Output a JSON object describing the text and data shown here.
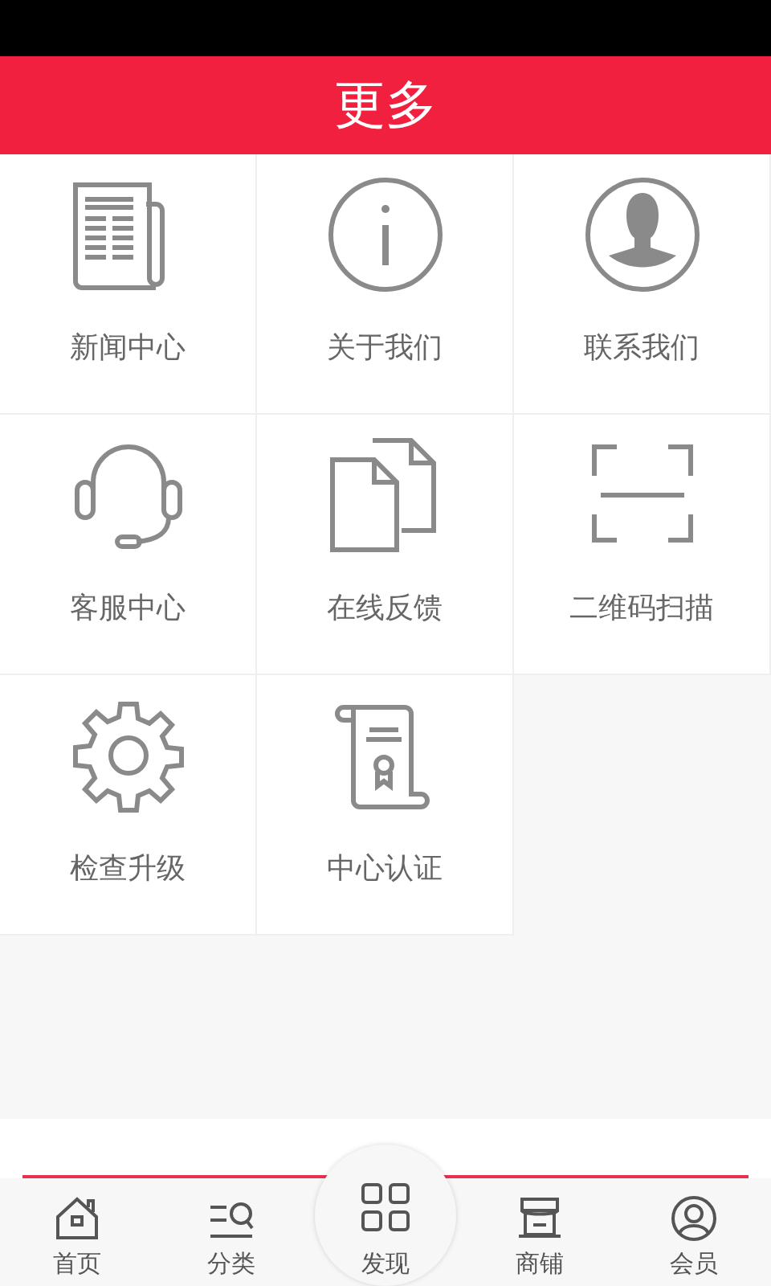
{
  "header": {
    "title": "更多"
  },
  "grid": [
    {
      "label": "新闻中心"
    },
    {
      "label": "关于我们"
    },
    {
      "label": "联系我们"
    },
    {
      "label": "客服中心"
    },
    {
      "label": "在线反馈"
    },
    {
      "label": "二维码扫描"
    },
    {
      "label": "检查升级"
    },
    {
      "label": "中心认证"
    }
  ],
  "bottom_nav": [
    {
      "label": "首页",
      "kind": "tab"
    },
    {
      "label": "分类",
      "kind": "tab"
    },
    {
      "label": "发现",
      "kind": "raised"
    },
    {
      "label": "商铺",
      "kind": "tab"
    },
    {
      "label": "会员",
      "kind": "tab"
    }
  ]
}
